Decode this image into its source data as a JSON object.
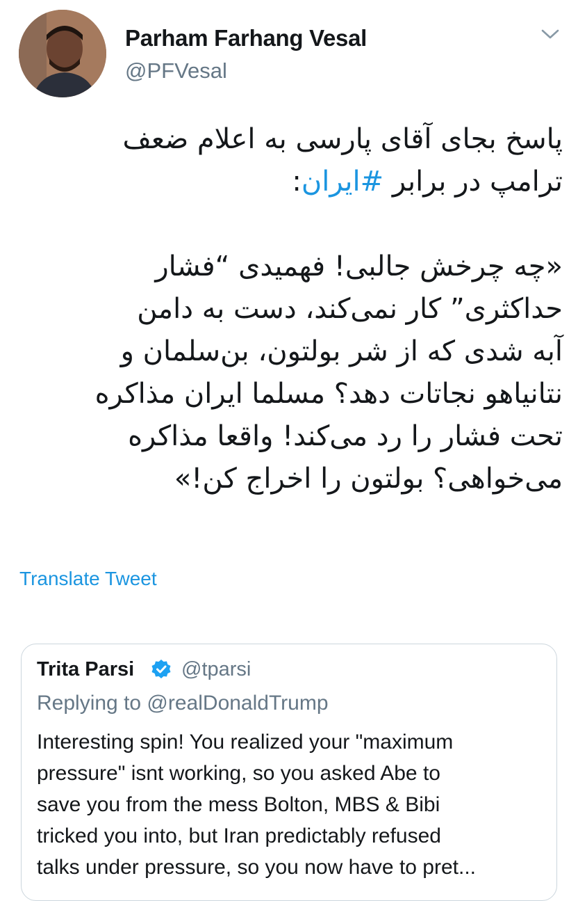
{
  "author": {
    "display_name": "Parham Farhang Vesal",
    "handle": "@PFVesal",
    "avatar_icon": "user-avatar-photo"
  },
  "tweet": {
    "line1": "پاسخ بجای آقای پارسی به اعلام ضعف",
    "line2_prefix": "ترامپ در برابر ",
    "hashtag": "#ایران",
    "line2_suffix": ":",
    "quote_lines": "«چه چرخش جالبی! فهمیدی “فشار\nحداکثری” کار نمی‌کند، دست به دامن\nآبه شدی که از شر بولتون، بن‌سلمان و\nنتانیاهو نجاتات دهد؟ مسلما ایران مذاکره\nتحت فشار را رد می‌کند! واقعا مذاکره\nمی‌خواهی؟ بولتون را اخراج کن!»",
    "translate_label": "Translate Tweet"
  },
  "quoted_tweet": {
    "name": "Trita Parsi",
    "handle": "@tparsi",
    "replying_to": "Replying to @realDonaldTrump",
    "text": "Interesting spin! You realized your \"maximum\npressure\" isnt working, so you asked Abe to\nsave you from the mess Bolton, MBS & Bibi\ntricked you into, but Iran predictably refused\ntalks under pressure, so you now have to pret..."
  },
  "colors": {
    "link": "#1b95e0",
    "secondary_text": "#657786",
    "border": "#ccd6dd",
    "verified": "#1da1f2"
  }
}
